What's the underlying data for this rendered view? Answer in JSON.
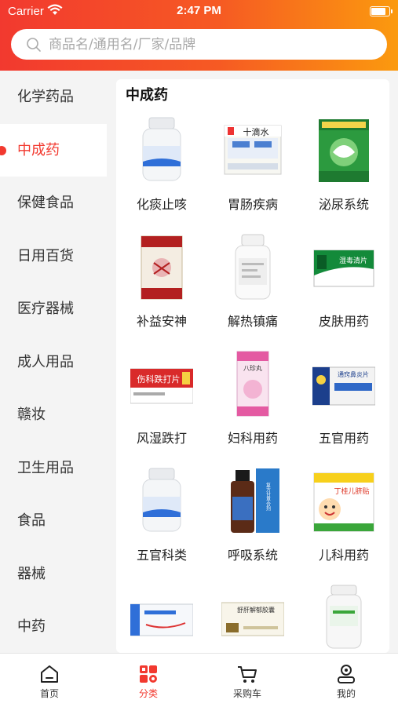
{
  "status_bar": {
    "carrier": "Carrier",
    "time": "2:47 PM",
    "battery_level": 0.9
  },
  "search": {
    "placeholder": "商品名/通用名/厂家/品牌"
  },
  "sidebar": {
    "items": [
      {
        "label": "化学药品",
        "active": false
      },
      {
        "label": "中成药",
        "active": true
      },
      {
        "label": "保健食品",
        "active": false
      },
      {
        "label": "日用百货",
        "active": false
      },
      {
        "label": "医疗器械",
        "active": false
      },
      {
        "label": "成人用品",
        "active": false
      },
      {
        "label": "赣妆",
        "active": false
      },
      {
        "label": "卫生用品",
        "active": false
      },
      {
        "label": "食品",
        "active": false
      },
      {
        "label": "器械",
        "active": false
      },
      {
        "label": "中药",
        "active": false
      }
    ]
  },
  "section": {
    "title": "中成药"
  },
  "categories": [
    {
      "label": "化痰止咳",
      "icon": "white-pill-bottle"
    },
    {
      "label": "胃肠疾病",
      "icon": "shidishui-medicine-box"
    },
    {
      "label": "泌尿系统",
      "icon": "green-granule-box"
    },
    {
      "label": "补益安神",
      "icon": "red-medicine-box"
    },
    {
      "label": "解热镇痛",
      "icon": "white-pill-bottle"
    },
    {
      "label": "皮肤用药",
      "icon": "green-tablet-box"
    },
    {
      "label": "风湿跌打",
      "icon": "red-tablet-box"
    },
    {
      "label": "妇科用药",
      "icon": "pink-medicine-box"
    },
    {
      "label": "五官用药",
      "icon": "blue-plaster-box"
    },
    {
      "label": "五官科类",
      "icon": "white-pill-bottle"
    },
    {
      "label": "呼吸系统",
      "icon": "syrup-bottle-box"
    },
    {
      "label": "儿科用药",
      "icon": "kids-plaster-box"
    },
    {
      "label": "",
      "icon": "white-tablet-box"
    },
    {
      "label": "",
      "icon": "capsule-box"
    },
    {
      "label": "",
      "icon": "white-pill-bottle"
    }
  ],
  "product_box_text": {
    "shidishui": "十滴水",
    "pifu": "湿毒清片",
    "fengshi": "伤科跌打片",
    "fuke": "八珍丸",
    "wuguan": "通窍鼻炎片",
    "huxi": "复方甘草合剂",
    "erke": "丁桂儿脐贴",
    "xiaoyao": "舒肝解郁胶囊"
  },
  "tabbar": {
    "tabs": [
      {
        "label": "首页",
        "icon": "home-icon",
        "active": false
      },
      {
        "label": "分类",
        "icon": "category-grid-icon",
        "active": true
      },
      {
        "label": "采购车",
        "icon": "shopping-cart-icon",
        "active": false
      },
      {
        "label": "我的",
        "icon": "profile-icon",
        "active": false
      }
    ]
  },
  "colors": {
    "accent": "#f2392f",
    "header_start": "#f2392f",
    "header_end": "#fb9a0e"
  }
}
